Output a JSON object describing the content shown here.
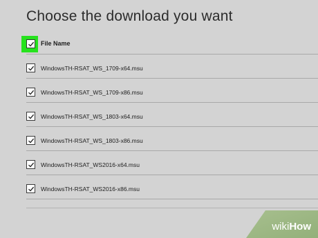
{
  "page": {
    "title": "Choose the download you want"
  },
  "table": {
    "select_all_checked": true,
    "header_label": "File Name",
    "rows": [
      {
        "file": "WindowsTH-RSAT_WS_1709-x64.msu",
        "checked": true
      },
      {
        "file": "WindowsTH-RSAT_WS_1709-x86.msu",
        "checked": true
      },
      {
        "file": "WindowsTH-RSAT_WS_1803-x64.msu",
        "checked": true
      },
      {
        "file": "WindowsTH-RSAT_WS_1803-x86.msu",
        "checked": true
      },
      {
        "file": "WindowsTH-RSAT_WS2016-x64.msu",
        "checked": true
      },
      {
        "file": "WindowsTH-RSAT_WS2016-x86.msu",
        "checked": true
      }
    ]
  },
  "watermark": {
    "prefix": "wiki",
    "suffix": "How"
  },
  "colors": {
    "background": "#d3d3d3",
    "highlight": "#27e21e",
    "watermark_bg": "#9bb683"
  }
}
